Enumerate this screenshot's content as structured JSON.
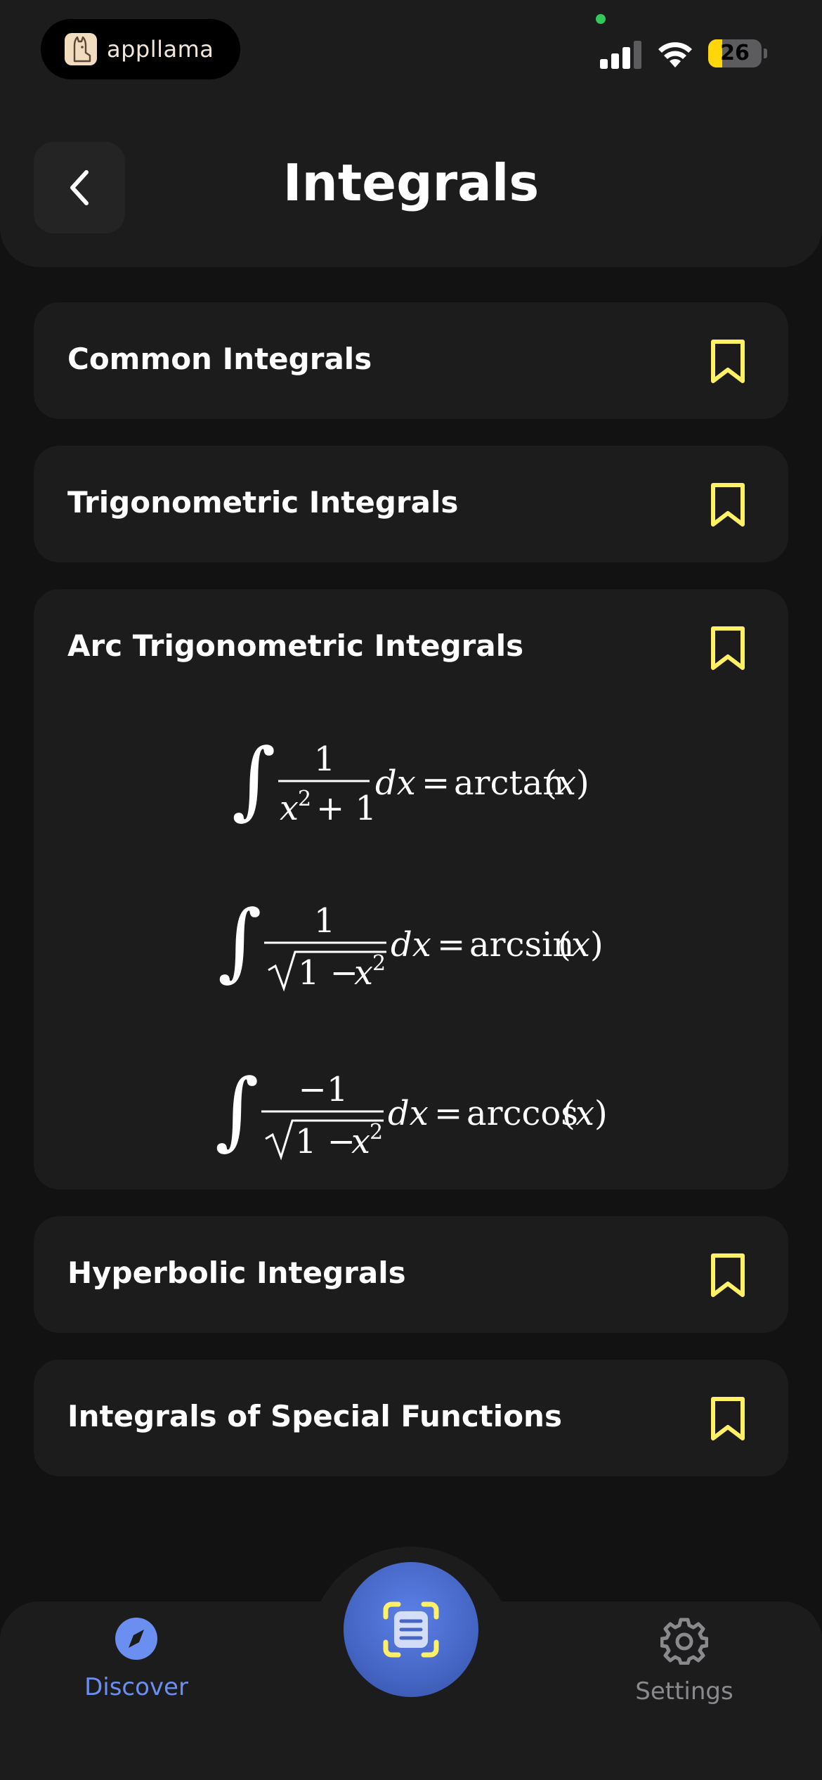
{
  "status_bar": {
    "brand": "appllama",
    "battery": "26"
  },
  "header": {
    "title": "Integrals"
  },
  "sections": [
    {
      "label": "Common Integrals"
    },
    {
      "label": "Trigonometric Integrals"
    },
    {
      "label": "Arc Trigonometric Integrals"
    },
    {
      "label": "Hyperbolic Integrals"
    },
    {
      "label": "Integrals of Special Functions"
    }
  ],
  "formulas": {
    "f1": {
      "num": "1",
      "rhs": "arctan",
      "arg": "x"
    },
    "f2": {
      "num": "1",
      "rhs": "arcsin",
      "arg": "x"
    },
    "f3": {
      "num": "−1",
      "rhs": "arccos",
      "arg": "x"
    }
  },
  "nav": {
    "discover": "Discover",
    "settings": "Settings"
  },
  "colors": {
    "accent_yellow": "#fff066",
    "accent_blue": "#6b8ff0",
    "card_bg": "#1c1c1d",
    "page_bg": "#121212"
  }
}
